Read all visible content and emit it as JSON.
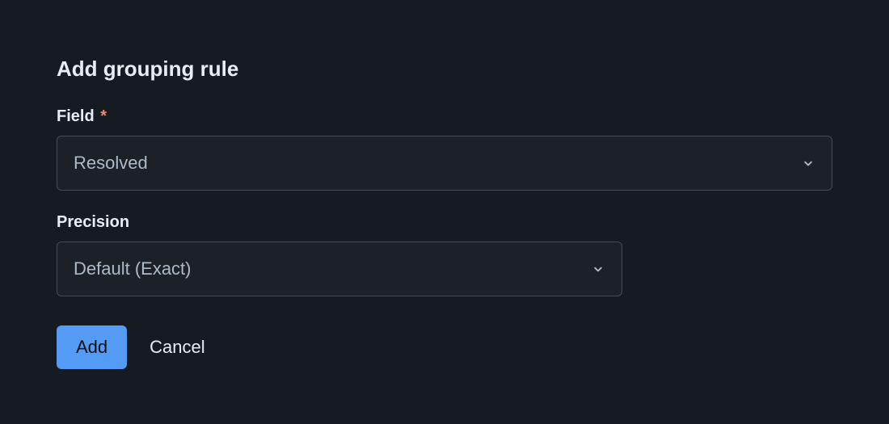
{
  "title": "Add grouping rule",
  "fields": {
    "field": {
      "label": "Field",
      "required_marker": "*",
      "value": "Resolved"
    },
    "precision": {
      "label": "Precision",
      "value": "Default (Exact)"
    }
  },
  "buttons": {
    "add": "Add",
    "cancel": "Cancel"
  }
}
